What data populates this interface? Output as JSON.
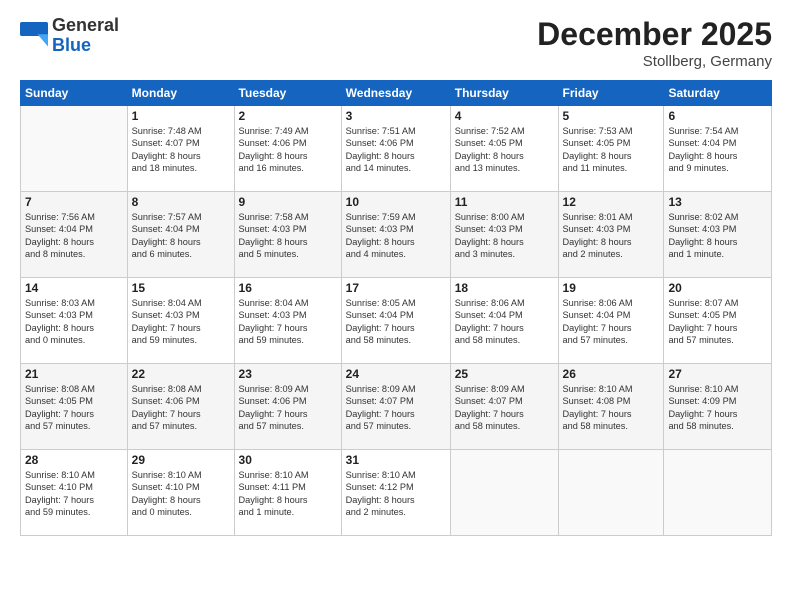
{
  "logo": {
    "general": "General",
    "blue": "Blue"
  },
  "header": {
    "month": "December 2025",
    "location": "Stollberg, Germany"
  },
  "weekdays": [
    "Sunday",
    "Monday",
    "Tuesday",
    "Wednesday",
    "Thursday",
    "Friday",
    "Saturday"
  ],
  "weeks": [
    [
      {
        "day": "",
        "info": ""
      },
      {
        "day": "1",
        "info": "Sunrise: 7:48 AM\nSunset: 4:07 PM\nDaylight: 8 hours\nand 18 minutes."
      },
      {
        "day": "2",
        "info": "Sunrise: 7:49 AM\nSunset: 4:06 PM\nDaylight: 8 hours\nand 16 minutes."
      },
      {
        "day": "3",
        "info": "Sunrise: 7:51 AM\nSunset: 4:06 PM\nDaylight: 8 hours\nand 14 minutes."
      },
      {
        "day": "4",
        "info": "Sunrise: 7:52 AM\nSunset: 4:05 PM\nDaylight: 8 hours\nand 13 minutes."
      },
      {
        "day": "5",
        "info": "Sunrise: 7:53 AM\nSunset: 4:05 PM\nDaylight: 8 hours\nand 11 minutes."
      },
      {
        "day": "6",
        "info": "Sunrise: 7:54 AM\nSunset: 4:04 PM\nDaylight: 8 hours\nand 9 minutes."
      }
    ],
    [
      {
        "day": "7",
        "info": "Sunrise: 7:56 AM\nSunset: 4:04 PM\nDaylight: 8 hours\nand 8 minutes."
      },
      {
        "day": "8",
        "info": "Sunrise: 7:57 AM\nSunset: 4:04 PM\nDaylight: 8 hours\nand 6 minutes."
      },
      {
        "day": "9",
        "info": "Sunrise: 7:58 AM\nSunset: 4:03 PM\nDaylight: 8 hours\nand 5 minutes."
      },
      {
        "day": "10",
        "info": "Sunrise: 7:59 AM\nSunset: 4:03 PM\nDaylight: 8 hours\nand 4 minutes."
      },
      {
        "day": "11",
        "info": "Sunrise: 8:00 AM\nSunset: 4:03 PM\nDaylight: 8 hours\nand 3 minutes."
      },
      {
        "day": "12",
        "info": "Sunrise: 8:01 AM\nSunset: 4:03 PM\nDaylight: 8 hours\nand 2 minutes."
      },
      {
        "day": "13",
        "info": "Sunrise: 8:02 AM\nSunset: 4:03 PM\nDaylight: 8 hours\nand 1 minute."
      }
    ],
    [
      {
        "day": "14",
        "info": "Sunrise: 8:03 AM\nSunset: 4:03 PM\nDaylight: 8 hours\nand 0 minutes."
      },
      {
        "day": "15",
        "info": "Sunrise: 8:04 AM\nSunset: 4:03 PM\nDaylight: 7 hours\nand 59 minutes."
      },
      {
        "day": "16",
        "info": "Sunrise: 8:04 AM\nSunset: 4:03 PM\nDaylight: 7 hours\nand 59 minutes."
      },
      {
        "day": "17",
        "info": "Sunrise: 8:05 AM\nSunset: 4:04 PM\nDaylight: 7 hours\nand 58 minutes."
      },
      {
        "day": "18",
        "info": "Sunrise: 8:06 AM\nSunset: 4:04 PM\nDaylight: 7 hours\nand 58 minutes."
      },
      {
        "day": "19",
        "info": "Sunrise: 8:06 AM\nSunset: 4:04 PM\nDaylight: 7 hours\nand 57 minutes."
      },
      {
        "day": "20",
        "info": "Sunrise: 8:07 AM\nSunset: 4:05 PM\nDaylight: 7 hours\nand 57 minutes."
      }
    ],
    [
      {
        "day": "21",
        "info": "Sunrise: 8:08 AM\nSunset: 4:05 PM\nDaylight: 7 hours\nand 57 minutes."
      },
      {
        "day": "22",
        "info": "Sunrise: 8:08 AM\nSunset: 4:06 PM\nDaylight: 7 hours\nand 57 minutes."
      },
      {
        "day": "23",
        "info": "Sunrise: 8:09 AM\nSunset: 4:06 PM\nDaylight: 7 hours\nand 57 minutes."
      },
      {
        "day": "24",
        "info": "Sunrise: 8:09 AM\nSunset: 4:07 PM\nDaylight: 7 hours\nand 57 minutes."
      },
      {
        "day": "25",
        "info": "Sunrise: 8:09 AM\nSunset: 4:07 PM\nDaylight: 7 hours\nand 58 minutes."
      },
      {
        "day": "26",
        "info": "Sunrise: 8:10 AM\nSunset: 4:08 PM\nDaylight: 7 hours\nand 58 minutes."
      },
      {
        "day": "27",
        "info": "Sunrise: 8:10 AM\nSunset: 4:09 PM\nDaylight: 7 hours\nand 58 minutes."
      }
    ],
    [
      {
        "day": "28",
        "info": "Sunrise: 8:10 AM\nSunset: 4:10 PM\nDaylight: 7 hours\nand 59 minutes."
      },
      {
        "day": "29",
        "info": "Sunrise: 8:10 AM\nSunset: 4:10 PM\nDaylight: 8 hours\nand 0 minutes."
      },
      {
        "day": "30",
        "info": "Sunrise: 8:10 AM\nSunset: 4:11 PM\nDaylight: 8 hours\nand 1 minute."
      },
      {
        "day": "31",
        "info": "Sunrise: 8:10 AM\nSunset: 4:12 PM\nDaylight: 8 hours\nand 2 minutes."
      },
      {
        "day": "",
        "info": ""
      },
      {
        "day": "",
        "info": ""
      },
      {
        "day": "",
        "info": ""
      }
    ]
  ]
}
